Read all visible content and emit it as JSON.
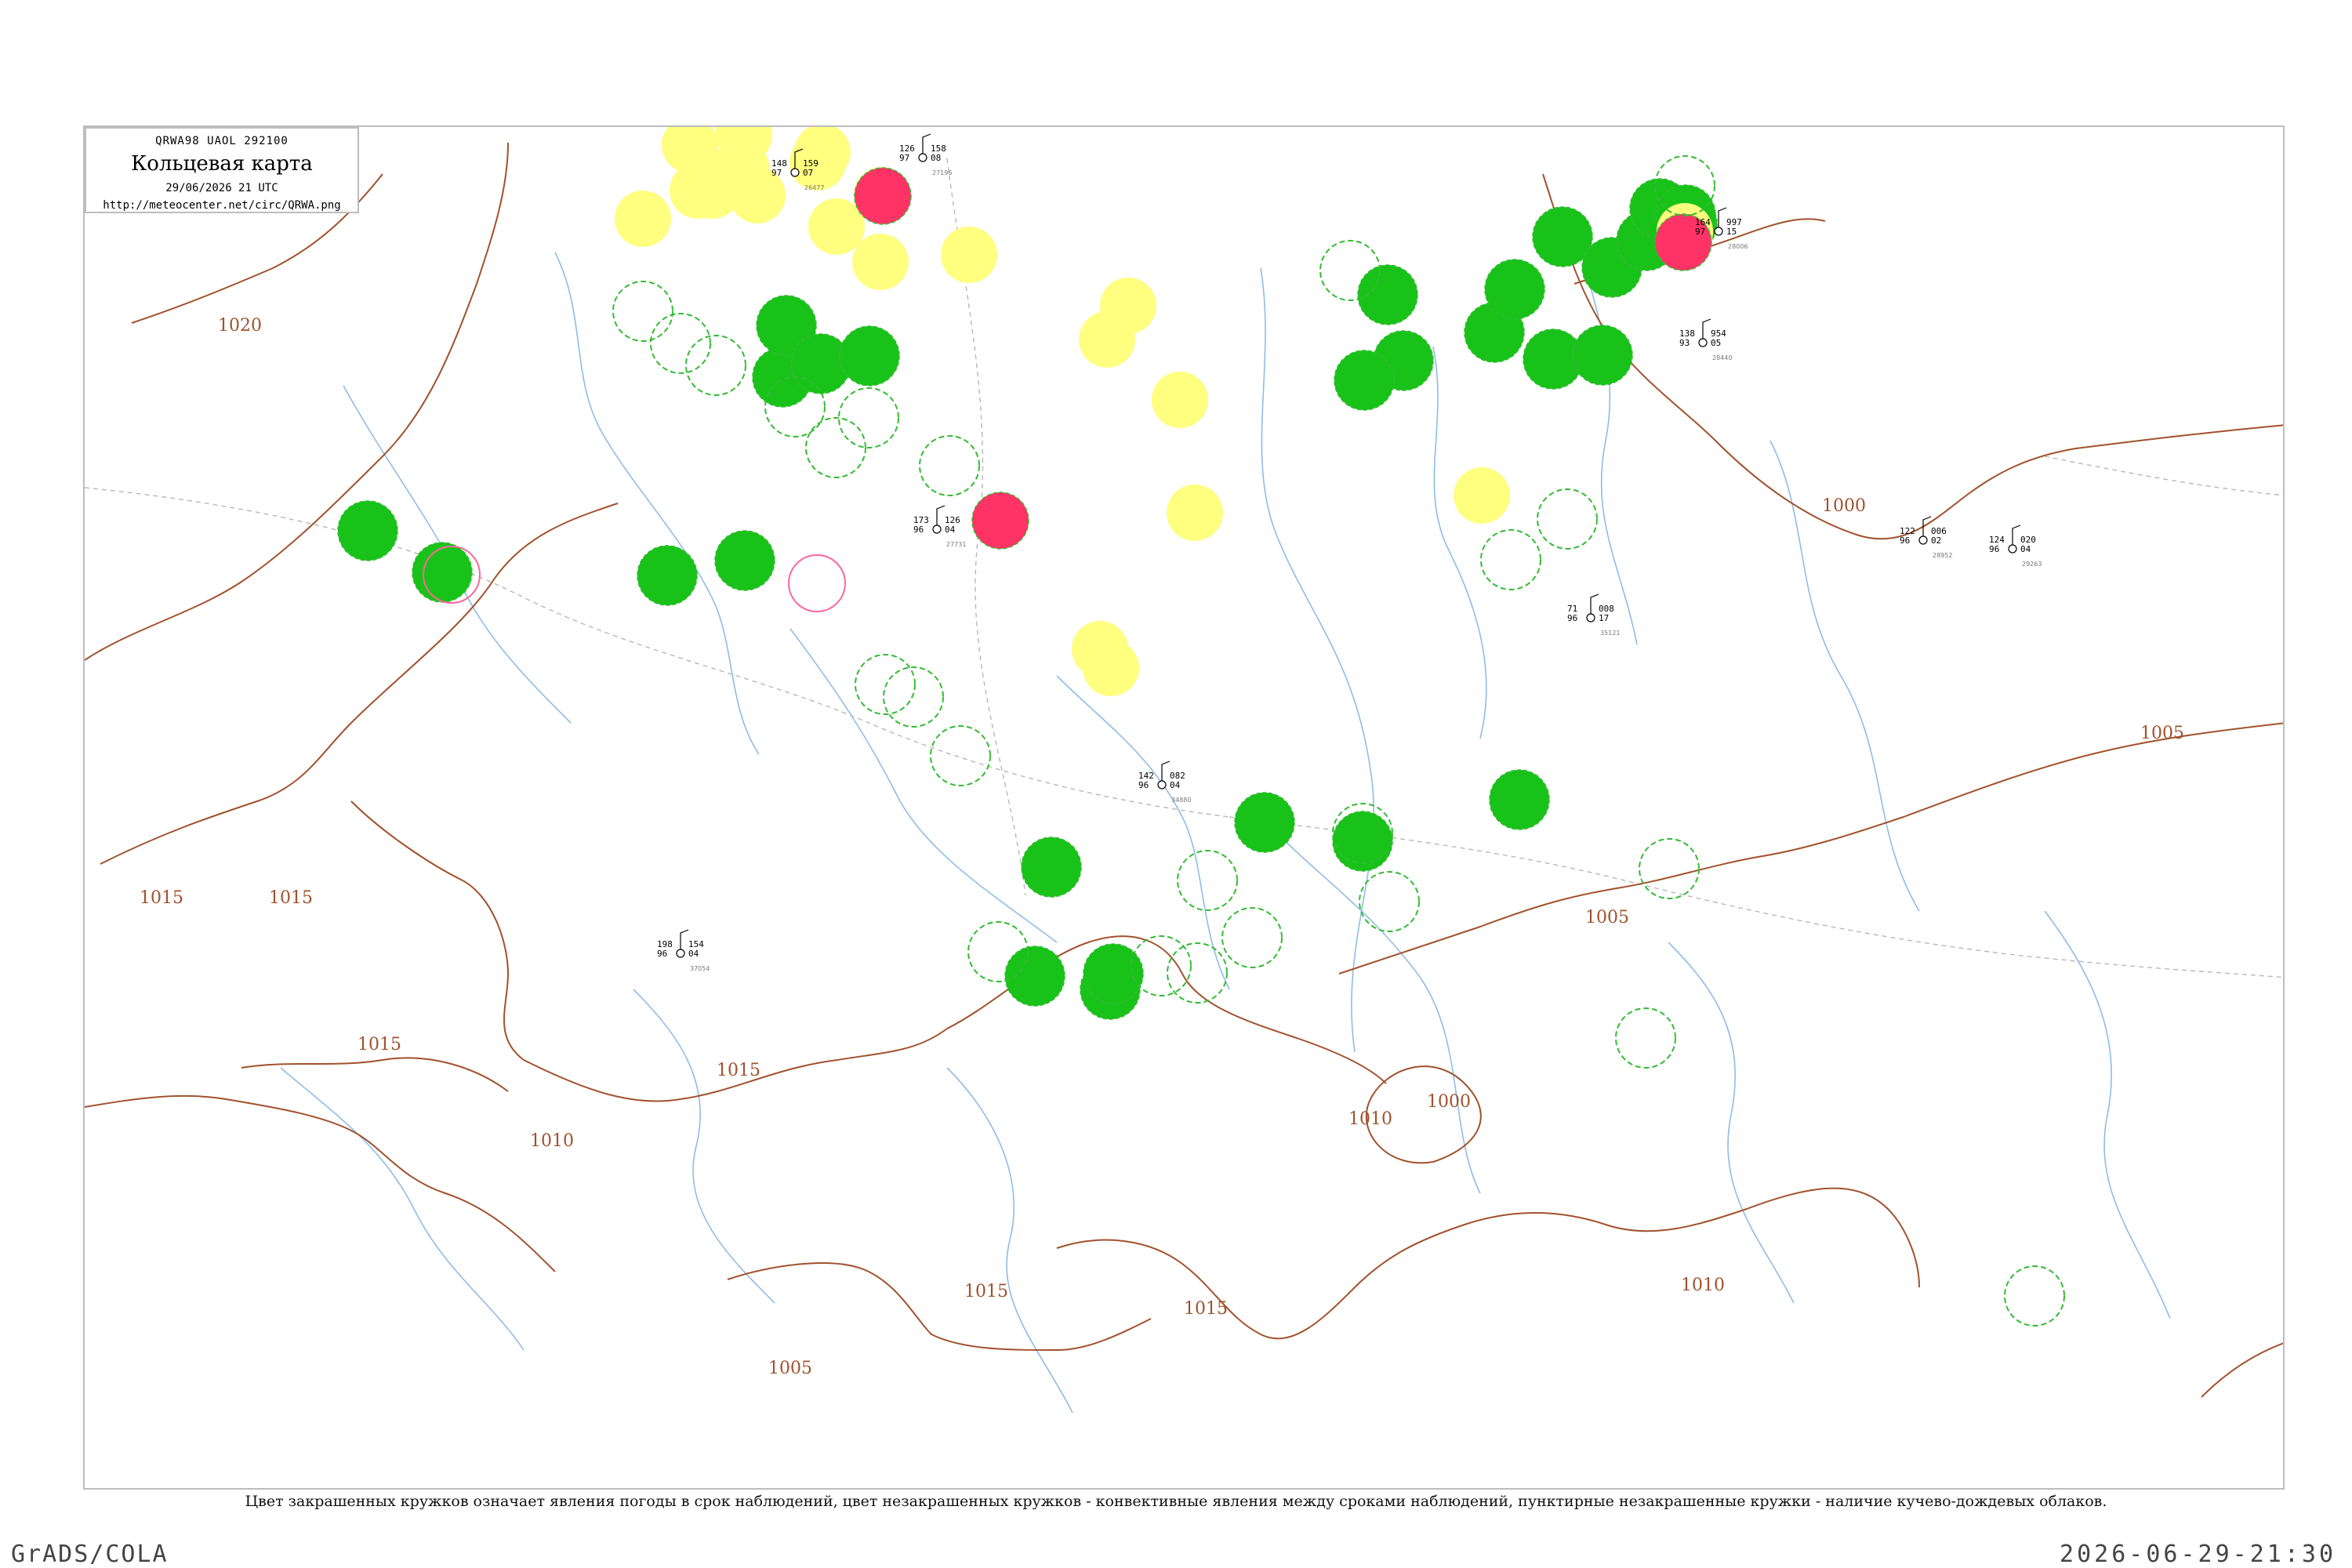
{
  "title_box": {
    "code_line": "QRWA98  UAOL  292100",
    "title": "Кольцевая карта",
    "datetime": "29/06/2026 21 UTC",
    "url": "http://meteocenter.net/circ/QRWA.png"
  },
  "caption": "Цвет закрашенных кружков означает явления погоды в срок наблюдений, цвет незакрашенных кружков - конвективные явления между сроками наблюдений, пунктирные незакрашенные кружки - наличие кучево-дождевых облаков.",
  "footer": {
    "left": "GrADS/COLA",
    "right": "2026-06-29-21:30"
  },
  "colors": {
    "isobar": "#a0522d",
    "river": "#7fb2e5",
    "border": "#b0b0b0",
    "precip_green": "#19c219",
    "fog_yellow": "#ffff80",
    "storm_red": "#ff3366",
    "cb_dashed": "#33bb33",
    "convective_pink": "#ff6699"
  },
  "isobar_labels": [
    "1020",
    "1015",
    "1015",
    "1015",
    "1015",
    "1015",
    "1015",
    "1010",
    "1010",
    "1005",
    "1005",
    "1005",
    "1000",
    "1000",
    "1000",
    "1010"
  ],
  "station_markers": {
    "green_filled": 28,
    "yellow_filled": 22,
    "red_filled": 3,
    "green_dashed_open": 24,
    "pink_open": 2
  },
  "station_samples": [
    {
      "t": "148",
      "p": "159",
      "d": "97",
      "tend": "07",
      "id": "26477"
    },
    {
      "t": "126",
      "p": "158",
      "d": "97",
      "tend": "08",
      "id": "27196"
    },
    {
      "t": "164",
      "p": "997",
      "d": "97",
      "tend": "15",
      "id": "28006"
    },
    {
      "t": "138",
      "p": "954",
      "d": "93",
      "tend": "05",
      "id": "28440"
    },
    {
      "t": "71",
      "p": "008",
      "d": "96",
      "tend": "17",
      "id": "35121"
    },
    {
      "t": "142",
      "p": "082",
      "d": "96",
      "tend": "04",
      "id": "34880"
    },
    {
      "t": "124",
      "p": "020",
      "d": "96",
      "tend": "04",
      "id": "29263"
    },
    {
      "t": "122",
      "p": "006",
      "d": "96",
      "tend": "02",
      "id": "28952"
    },
    {
      "t": "198",
      "p": "154",
      "d": "96",
      "tend": "04",
      "id": "37054"
    },
    {
      "t": "173",
      "p": "126",
      "d": "96",
      "tend": "04",
      "id": "27731"
    }
  ]
}
